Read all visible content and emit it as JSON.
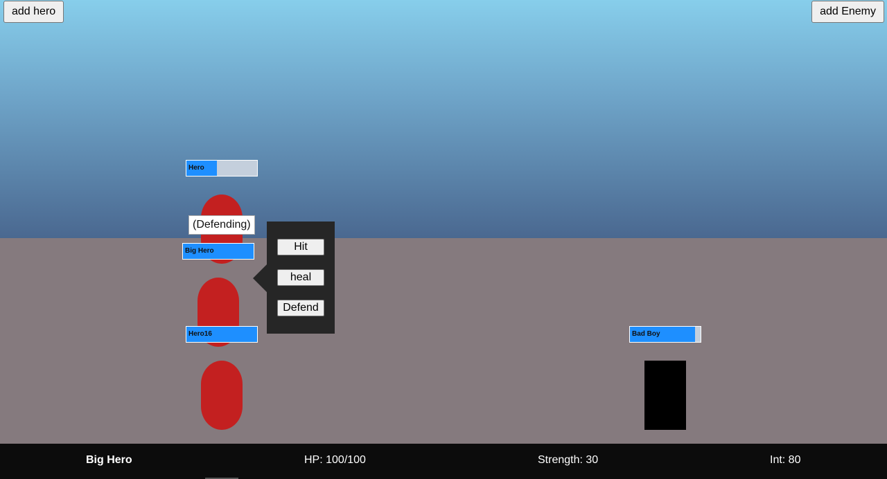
{
  "toolbar": {
    "add_hero_label": "add hero",
    "add_enemy_label": "add Enemy"
  },
  "heroes": [
    {
      "name": "Hero",
      "hp_fraction": 0.43
    },
    {
      "name": "Big Hero",
      "hp_fraction": 1.0,
      "status": "(Defending)",
      "selected": true
    },
    {
      "name": "Hero16",
      "hp_fraction": 1.0
    }
  ],
  "enemies": [
    {
      "name": "Bad Boy",
      "hp_fraction": 0.92
    }
  ],
  "action_menu": {
    "hit_label": "Hit",
    "heal_label": "heal",
    "defend_label": "Defend"
  },
  "selected_stats": {
    "name": "Big Hero",
    "hp": "HP: 100/100",
    "strength": "Strength: 30",
    "int": "Int: 80"
  },
  "colors": {
    "sky_top": "#87ceeb",
    "sky_bottom": "#4a6890",
    "ground": "#857a7e",
    "hp_fill": "#1e8fff",
    "hp_empty": "#c4cfdc",
    "hero": "#c32020",
    "enemy": "#000000",
    "menu_bg": "#262626",
    "stats_bg": "#0c0c0c"
  }
}
